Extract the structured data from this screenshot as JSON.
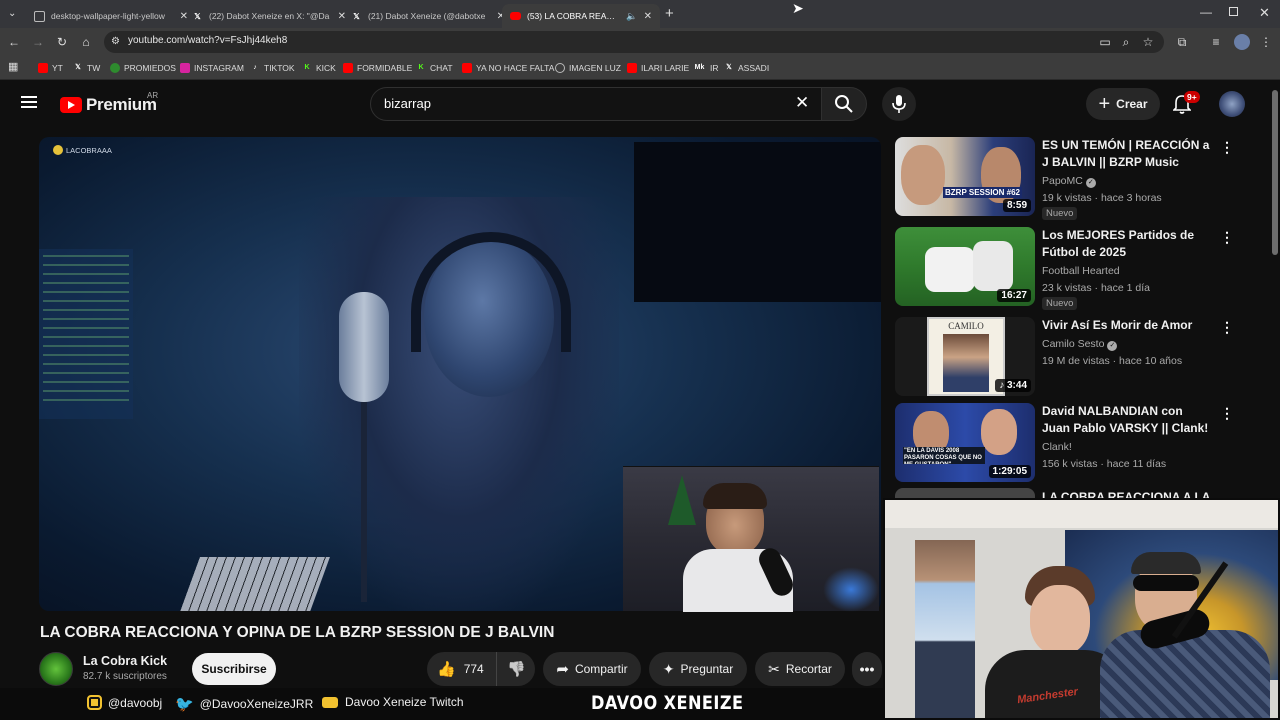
{
  "browser": {
    "tabs": [
      {
        "title": "desktop-wallpaper-light-yellow",
        "favicon": "image-icon"
      },
      {
        "title": "(22) Dabot Xeneize en X: \"@Da",
        "favicon": "x-icon"
      },
      {
        "title": "(21) Dabot Xeneize (@dabotxe",
        "favicon": "x-icon"
      },
      {
        "title": "(53) LA COBRA REACCIONA",
        "favicon": "youtube-icon",
        "active": true
      }
    ],
    "url": "youtube.com/watch?v=FsJhj44keh8",
    "bookmarks": [
      {
        "label": "YT",
        "color": "#ff0000"
      },
      {
        "label": "TW",
        "color": "#000000"
      },
      {
        "label": "PROMIEDOS",
        "color": "#2e8b2e"
      },
      {
        "label": "INSTAGRAM",
        "color": "#d6249f"
      },
      {
        "label": "TIKTOK",
        "color": "#111111"
      },
      {
        "label": "KICK",
        "color": "#53fc18"
      },
      {
        "label": "FORMIDABLE",
        "color": "#ff0000"
      },
      {
        "label": "CHAT",
        "color": "#53fc18"
      },
      {
        "label": "YA NO HACE FALTA",
        "color": "#ff0000"
      },
      {
        "label": "IMAGEN LUZ",
        "color": "#777777"
      },
      {
        "label": "ILARI LARIE",
        "color": "#ff0000"
      },
      {
        "label": "IR",
        "color": "#222222"
      },
      {
        "label": "ASSADI",
        "color": "#000000"
      }
    ]
  },
  "youtube": {
    "logo_text": "Premium",
    "region": "AR",
    "search_value": "bizarrap",
    "create_label": "Crear",
    "notif_count": "9+"
  },
  "video": {
    "watermark": "LACOBRAAA",
    "title": "LA COBRA REACCIONA Y OPINA DE LA BZRP SESSION DE J BALVIN",
    "channel": "La Cobra Kick",
    "subscribers": "82.7 k suscriptores",
    "subscribe_label": "Suscribirse",
    "likes": "774",
    "share_label": "Compartir",
    "ask_label": "Preguntar",
    "clip_label": "Recortar"
  },
  "recommendations": [
    {
      "title": "ES UN TEMÓN | REACCIÓN a J BALVIN || BZRP Music Session...",
      "channel": "PapoMC",
      "verified": true,
      "views": "19 k vistas",
      "age": "hace 3 horas",
      "badge": "Nuevo",
      "duration": "8:59",
      "thumb_text": "BZRP SESSION #62"
    },
    {
      "title": "Los MEJORES Partidos de Fútbol de 2025",
      "channel": "Football Hearted",
      "verified": false,
      "views": "23 k vistas",
      "age": "hace 1 día",
      "badge": "Nuevo",
      "duration": "16:27",
      "thumb_text": ""
    },
    {
      "title": "Vivir Así Es Morir de Amor",
      "channel": "Camilo Sesto",
      "verified": true,
      "views": "19 M de vistas",
      "age": "hace 10 años",
      "badge": "",
      "duration": "3:44",
      "thumb_text": "CAMILO"
    },
    {
      "title": "David NALBANDIAN con Juan Pablo VARSKY || Clank! Game ...",
      "channel": "Clank!",
      "verified": false,
      "views": "156 k vistas",
      "age": "hace 11 días",
      "badge": "",
      "duration": "1:29:05",
      "thumb_text": "\"EN LA DAVIS 2008 PASARON COSAS QUE NO ME GUSTARON\""
    },
    {
      "title": "LA COBRA REACCIONA A LA",
      "channel": "",
      "verified": false,
      "views": "",
      "age": "",
      "badge": "",
      "duration": "",
      "thumb_text": ""
    }
  ],
  "stream_footer": {
    "instagram": "@davoobj",
    "twitter": "@DavooXeneizeJRR",
    "twitch": "Davoo Xeneize Twitch",
    "brand": "DAVOO XENEIZE"
  },
  "cam_text": "Manchester"
}
